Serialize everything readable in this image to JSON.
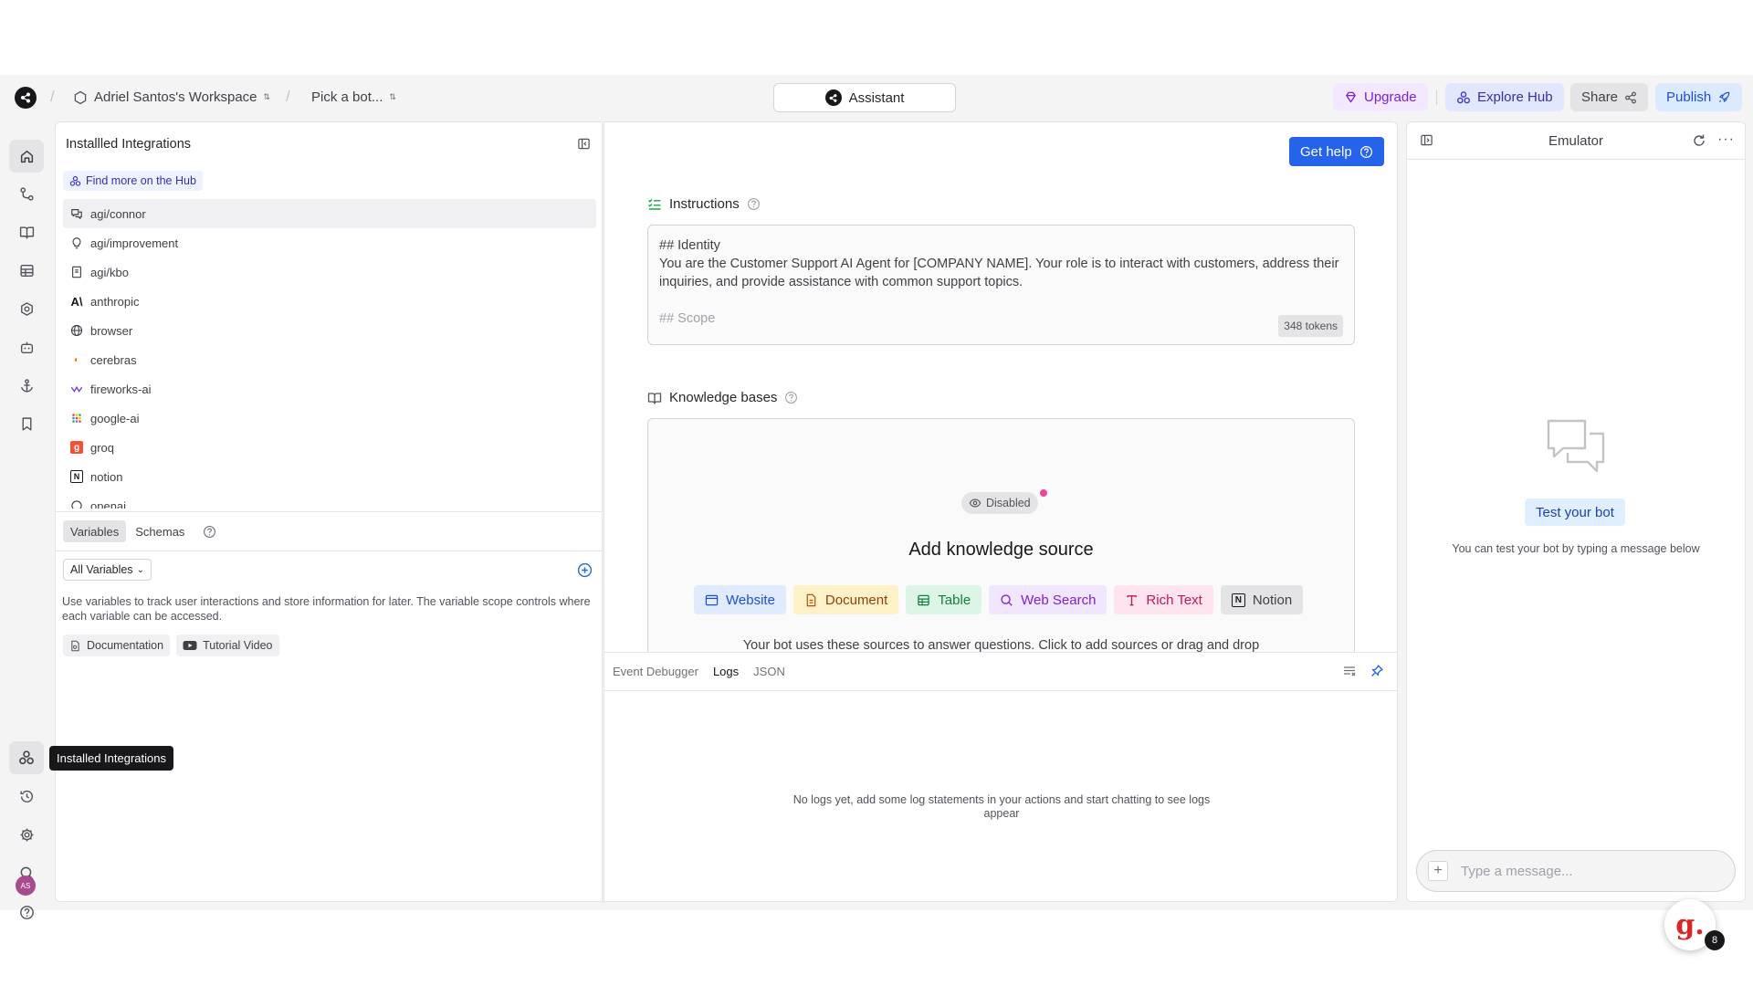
{
  "topbar": {
    "workspace": "Adriel Santos's Workspace",
    "bot_picker": "Pick a bot...",
    "assistant_label": "Assistant",
    "upgrade_label": "Upgrade",
    "explore_hub_label": "Explore Hub",
    "share_label": "Share",
    "publish_label": "Publish"
  },
  "nav": {
    "tooltip": "Installed Integrations",
    "avatar_initials": "AS"
  },
  "left_panel": {
    "title": "Installled Integrations",
    "hub_link": "Find more on the Hub",
    "integrations": [
      {
        "name": "agi/connor",
        "icon": "chat-icon",
        "selected": true
      },
      {
        "name": "agi/improvement",
        "icon": "lightbulb-icon"
      },
      {
        "name": "agi/kbo",
        "icon": "book-icon"
      },
      {
        "name": "anthropic",
        "icon": "anthropic-icon"
      },
      {
        "name": "browser",
        "icon": "globe-icon"
      },
      {
        "name": "cerebras",
        "icon": "cerebras-icon"
      },
      {
        "name": "fireworks-ai",
        "icon": "fireworks-icon"
      },
      {
        "name": "google-ai",
        "icon": "google-ai-icon"
      },
      {
        "name": "groq",
        "icon": "groq-icon"
      },
      {
        "name": "notion",
        "icon": "notion-icon"
      },
      {
        "name": "openai",
        "icon": "openai-icon"
      }
    ],
    "tabs": [
      "Variables",
      "Schemas"
    ],
    "variable_filter": "All Variables",
    "description": "Use variables to track user interactions and store information for later. The variable scope controls where each variable can be accessed.",
    "doc_chip": "Documentation",
    "video_chip": "Tutorial Video"
  },
  "center": {
    "get_help": "Get help",
    "instructions_title": "Instructions",
    "instructions_line1": "## Identity",
    "instructions_line2": "You are the Customer Support AI Agent for [COMPANY NAME]. Your role is to interact with customers, address their inquiries, and provide assistance with common support topics.",
    "instructions_line3": "## Scope",
    "tokens": "348 tokens",
    "kb_title": "Knowledge bases",
    "disabled_label": "Disabled",
    "add_source_title": "Add knowledge source",
    "source_buttons": [
      {
        "label": "Website",
        "bg": "#e0ecfd",
        "fg": "#1d4ed8"
      },
      {
        "label": "Document",
        "bg": "#fdf1c7",
        "fg": "#92400e"
      },
      {
        "label": "Table",
        "bg": "#dcf5e6",
        "fg": "#15803d"
      },
      {
        "label": "Web Search",
        "bg": "#f0e6fd",
        "fg": "#7e22ce"
      },
      {
        "label": "Rich Text",
        "bg": "#fde4ef",
        "fg": "#be185d"
      },
      {
        "label": "Notion",
        "bg": "#e4e4e7",
        "fg": "#3f3f46"
      }
    ],
    "kb_description": "Your bot uses these sources to answer questions. Click to add sources or drag and drop"
  },
  "debugger": {
    "tabs": [
      "Event Debugger",
      "Logs",
      "JSON"
    ],
    "active_tab": "Logs",
    "empty_message": "No logs yet, add some log statements in your actions and start chatting to see logs appear"
  },
  "emulator": {
    "title": "Emulator",
    "test_button": "Test your bot",
    "test_description": "You can test your bot by typing a message below",
    "input_placeholder": "Type a message...",
    "badge_letter": "g.",
    "badge_count": "8"
  }
}
